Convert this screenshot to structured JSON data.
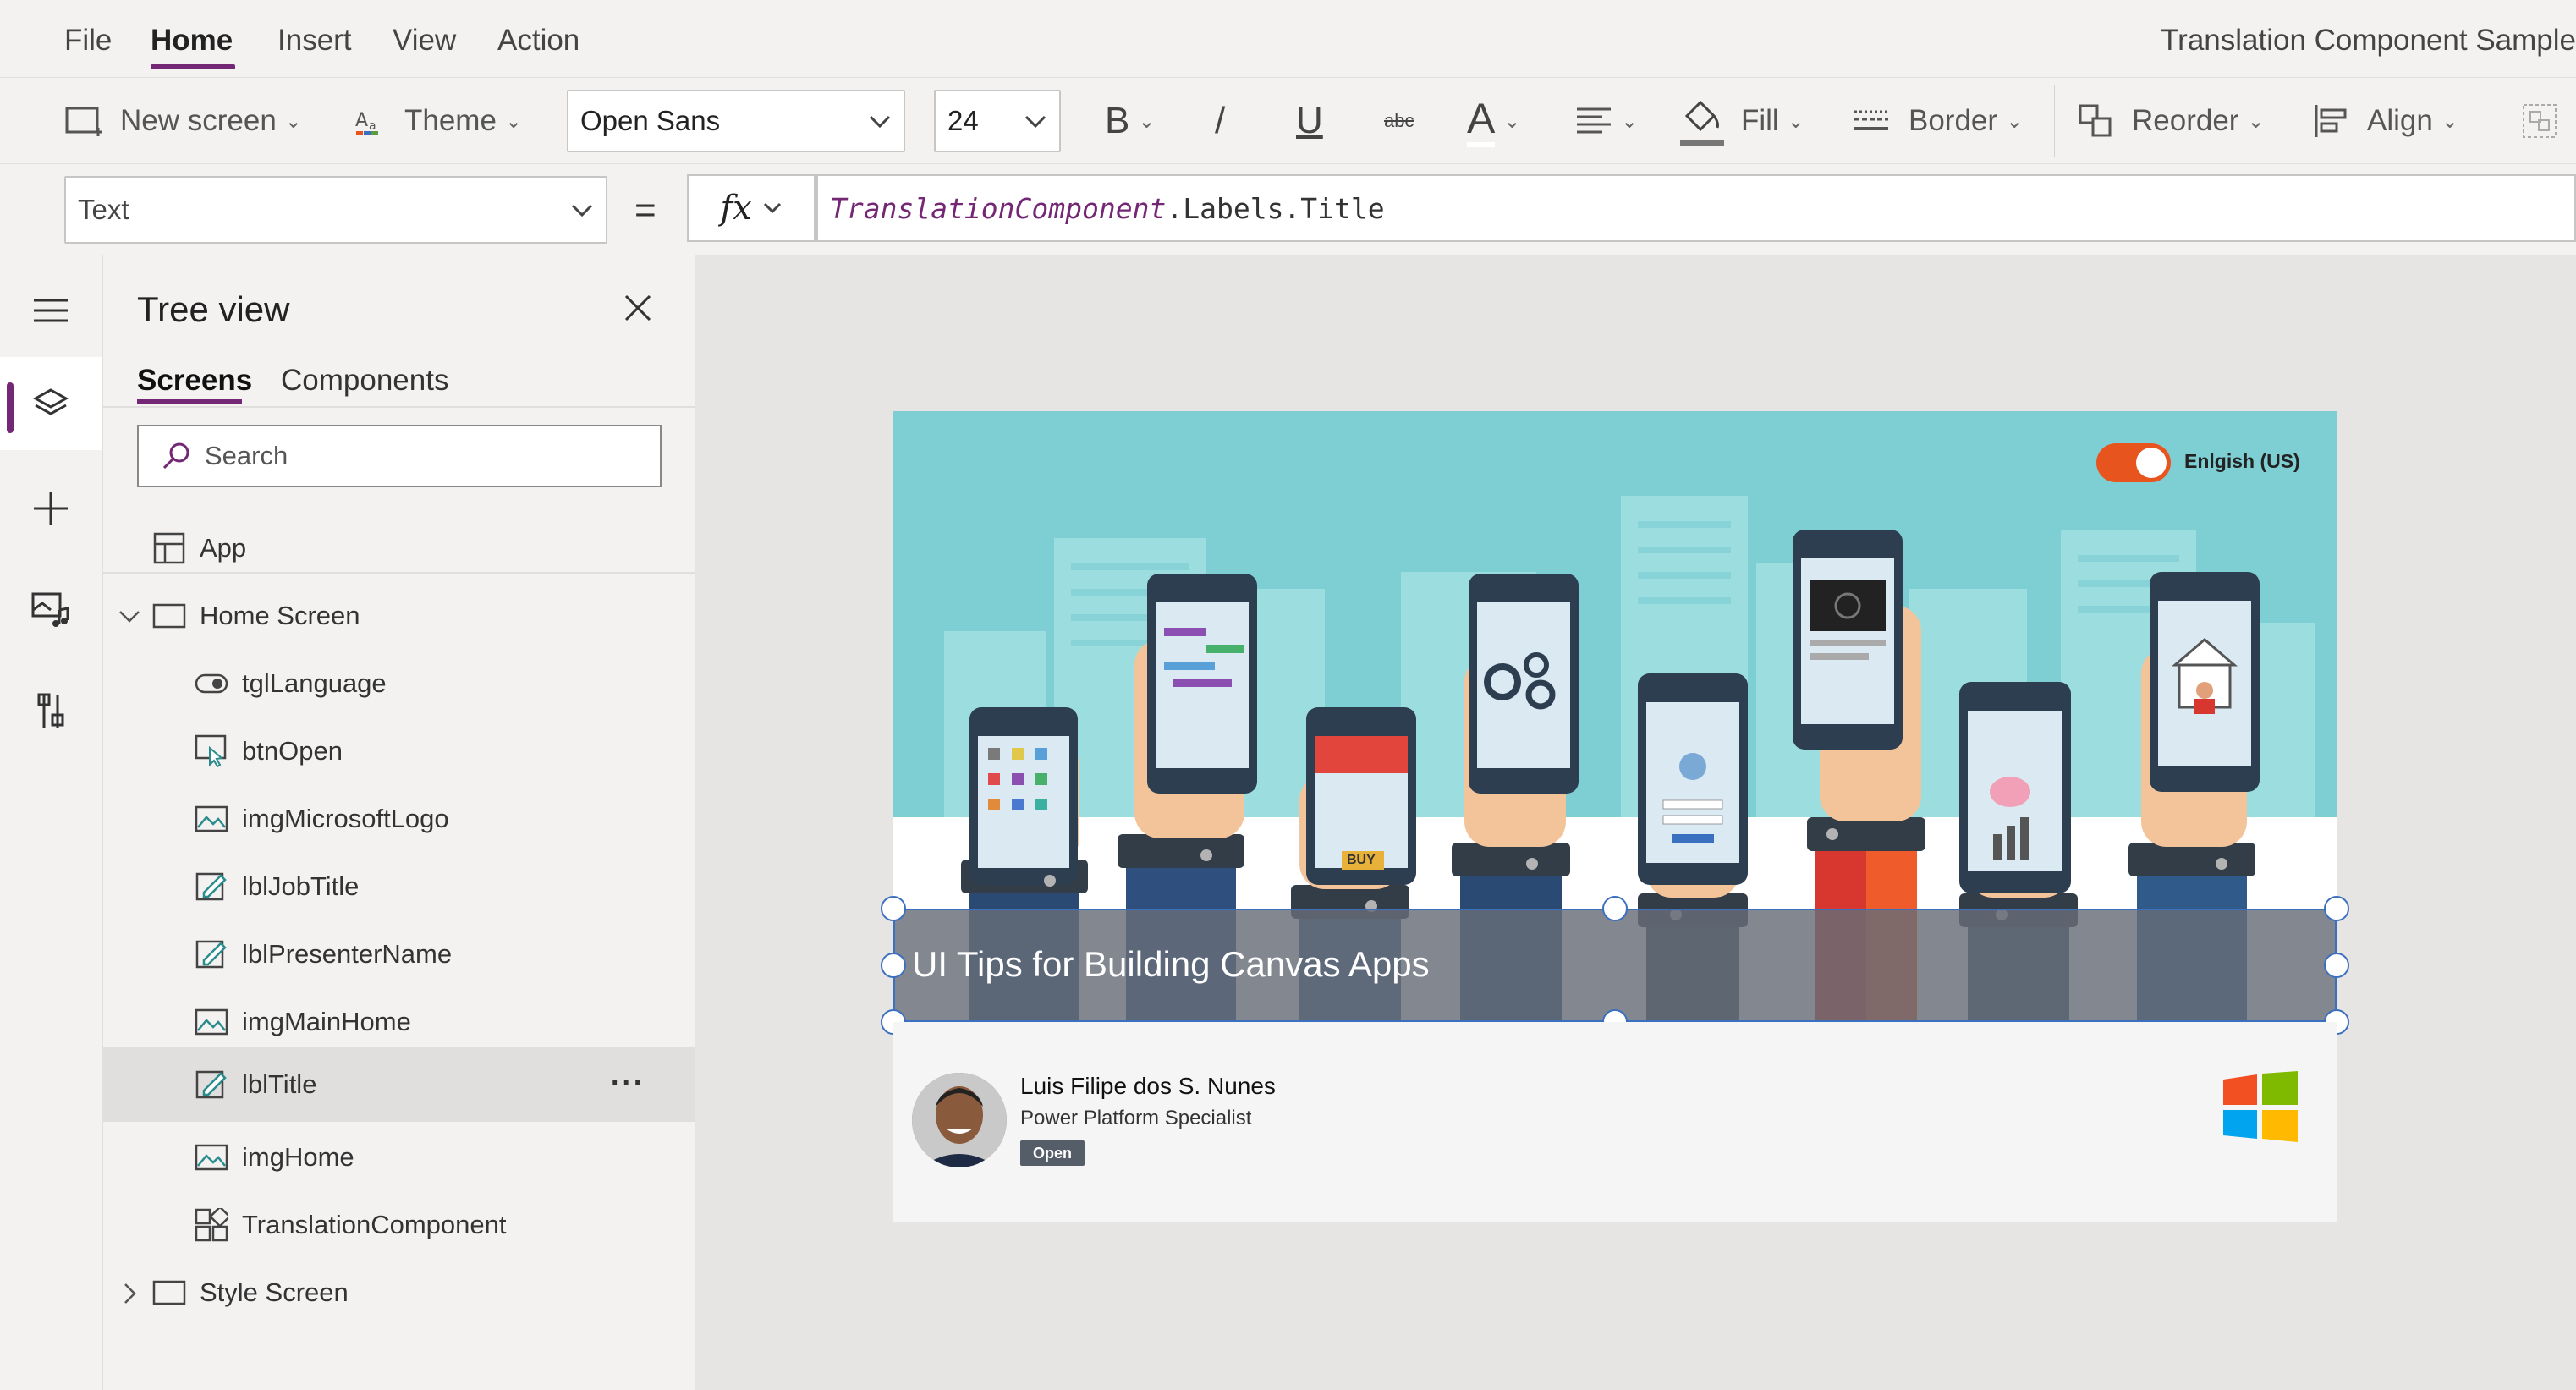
{
  "menu": {
    "items": [
      "File",
      "Home",
      "Insert",
      "View",
      "Action"
    ],
    "active": "Home",
    "app_title": "Translation Component Sample"
  },
  "ribbon": {
    "new_screen": "New screen",
    "theme": "Theme",
    "font_family": "Open Sans",
    "font_size": "24",
    "bold": "B",
    "italic": "/",
    "underline": "U",
    "strikethrough": "abc",
    "font_color": "A",
    "fill": "Fill",
    "border": "Border",
    "reorder": "Reorder",
    "align": "Align"
  },
  "formula_bar": {
    "property": "Text",
    "equals": "=",
    "fx": "fx",
    "formula_object": "TranslationComponent",
    "formula_rest": ".Labels.Title"
  },
  "tree_view": {
    "title": "Tree view",
    "tabs": [
      "Screens",
      "Components"
    ],
    "active_tab": "Screens",
    "search_placeholder": "Search",
    "app_label": "App",
    "screens": [
      {
        "name": "Home Screen",
        "expanded": true,
        "children": [
          {
            "name": "tglLanguage",
            "icon": "toggle-icon"
          },
          {
            "name": "btnOpen",
            "icon": "button-icon"
          },
          {
            "name": "imgMicrosoftLogo",
            "icon": "image-icon"
          },
          {
            "name": "lblJobTitle",
            "icon": "label-icon"
          },
          {
            "name": "lblPresenterName",
            "icon": "label-icon"
          },
          {
            "name": "imgMainHome",
            "icon": "image-icon"
          },
          {
            "name": "lblTitle",
            "icon": "label-icon",
            "selected": true
          },
          {
            "name": "imgHome",
            "icon": "image-icon"
          },
          {
            "name": "TranslationComponent",
            "icon": "component-icon"
          }
        ]
      },
      {
        "name": "Style Screen",
        "expanded": false,
        "children": []
      }
    ],
    "more_label": "..."
  },
  "canvas": {
    "toggle_label": "Enlgish (US)",
    "toggle_on": true,
    "title": "UI Tips for Building Canvas Apps",
    "presenter_name": "Luis Filipe dos S. Nunes",
    "job_title": "Power Platform Specialist",
    "open_button": "Open",
    "buy_label": "BUY"
  },
  "colors": {
    "accent": "#742774",
    "toggle": "#e8541e",
    "selection": "#3b6fbf",
    "hero_bg": "#7ecfd4"
  }
}
